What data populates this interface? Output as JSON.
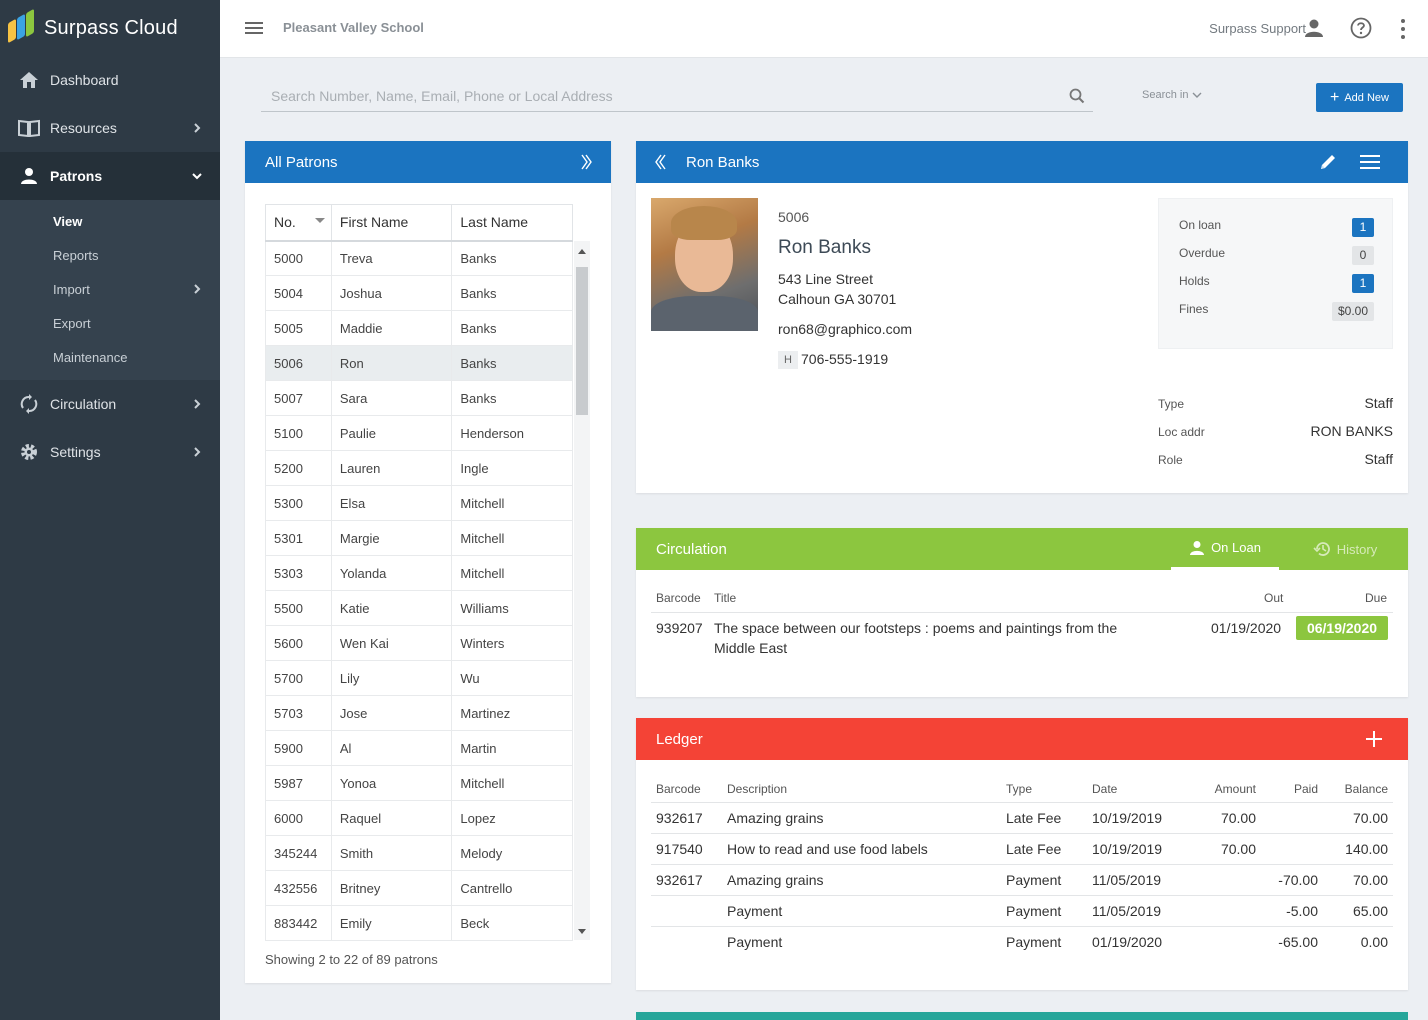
{
  "brand": {
    "name": "Surpass Cloud"
  },
  "sidebar": {
    "items": [
      {
        "label": "Dashboard"
      },
      {
        "label": "Resources"
      },
      {
        "label": "Patrons"
      },
      {
        "label": "Circulation"
      },
      {
        "label": "Settings"
      }
    ],
    "patron_sub": [
      {
        "label": "View"
      },
      {
        "label": "Reports"
      },
      {
        "label": "Import"
      },
      {
        "label": "Export"
      },
      {
        "label": "Maintenance"
      }
    ]
  },
  "topbar": {
    "school": "Pleasant Valley School",
    "support": "Surpass Support"
  },
  "search": {
    "placeholder": "Search Number, Name, Email, Phone or Local Address",
    "search_in": "Search in",
    "add_new": "Add New"
  },
  "patrons": {
    "title": "All Patrons",
    "columns": [
      "No.",
      "First Name",
      "Last Name"
    ],
    "rows": [
      [
        "5000",
        "Treva",
        "Banks"
      ],
      [
        "5004",
        "Joshua",
        "Banks"
      ],
      [
        "5005",
        "Maddie",
        "Banks"
      ],
      [
        "5006",
        "Ron",
        "Banks"
      ],
      [
        "5007",
        "Sara",
        "Banks"
      ],
      [
        "5100",
        "Paulie",
        "Henderson"
      ],
      [
        "5200",
        "Lauren",
        "Ingle"
      ],
      [
        "5300",
        "Elsa",
        "Mitchell"
      ],
      [
        "5301",
        "Margie",
        "Mitchell"
      ],
      [
        "5303",
        "Yolanda",
        "Mitchell"
      ],
      [
        "5500",
        "Katie",
        "Williams"
      ],
      [
        "5600",
        "Wen Kai",
        "Winters"
      ],
      [
        "5700",
        "Lily",
        "Wu"
      ],
      [
        "5703",
        "Jose",
        "Martinez"
      ],
      [
        "5900",
        "Al",
        "Martin"
      ],
      [
        "5987",
        "Yonoa",
        "Mitchell"
      ],
      [
        "6000",
        "Raquel",
        "Lopez"
      ],
      [
        "345244",
        "Smith",
        "Melody"
      ],
      [
        "432556",
        "Britney",
        "Cantrello"
      ],
      [
        "883442",
        "Emily",
        "Beck"
      ]
    ],
    "selected_index": 3,
    "showing": "Showing 2 to 22 of 89 patrons"
  },
  "patron": {
    "header": "Ron Banks",
    "number": "5006",
    "name": "Ron Banks",
    "address1": "543 Line Street",
    "address2": "Calhoun GA 30701",
    "email": "ron68@graphico.com",
    "phone_tag": "H",
    "phone": "706-555-1919",
    "stats": [
      {
        "label": "On loan",
        "value": "1"
      },
      {
        "label": "Overdue",
        "value": "0"
      },
      {
        "label": "Holds",
        "value": "1"
      },
      {
        "label": "Fines",
        "value": "$0.00"
      }
    ],
    "info": [
      {
        "label": "Type",
        "value": "Staff"
      },
      {
        "label": "Loc addr",
        "value": "RON BANKS"
      },
      {
        "label": "Role",
        "value": "Staff"
      }
    ]
  },
  "circulation": {
    "title": "Circulation",
    "tab_onloan": "On Loan",
    "tab_history": "History",
    "headers": {
      "barcode": "Barcode",
      "title": "Title",
      "out": "Out",
      "due": "Due"
    },
    "rows": [
      {
        "barcode": "939207",
        "title_line1": "The space between our footsteps : poems and paintings from the",
        "title_line2": "Middle East",
        "out": "01/19/2020",
        "due": "06/19/2020"
      }
    ]
  },
  "ledger": {
    "title": "Ledger",
    "headers": {
      "barcode": "Barcode",
      "description": "Description",
      "type": "Type",
      "date": "Date",
      "amount": "Amount",
      "paid": "Paid",
      "balance": "Balance"
    },
    "rows": [
      {
        "barcode": "932617",
        "description": "Amazing grains",
        "type": "Late Fee",
        "date": "10/19/2019",
        "amount": "70.00",
        "paid": "",
        "balance": "70.00"
      },
      {
        "barcode": "917540",
        "description": "How to read and use food labels",
        "type": "Late Fee",
        "date": "10/19/2019",
        "amount": "70.00",
        "paid": "",
        "balance": "140.00"
      },
      {
        "barcode": "932617",
        "description": "Amazing grains",
        "type": "Payment",
        "date": "11/05/2019",
        "amount": "",
        "paid": "-70.00",
        "balance": "70.00"
      },
      {
        "barcode": "",
        "description": "Payment",
        "type": "Payment",
        "date": "11/05/2019",
        "amount": "",
        "paid": "-5.00",
        "balance": "65.00"
      },
      {
        "barcode": "",
        "description": "Payment",
        "type": "Payment",
        "date": "01/19/2020",
        "amount": "",
        "paid": "-65.00",
        "balance": "0.00"
      }
    ]
  },
  "colors": {
    "sidebar": "#2e3a45",
    "primary": "#1b74c0",
    "circulation": "#8cc63f",
    "ledger": "#f44336",
    "teal": "#26a69a"
  }
}
